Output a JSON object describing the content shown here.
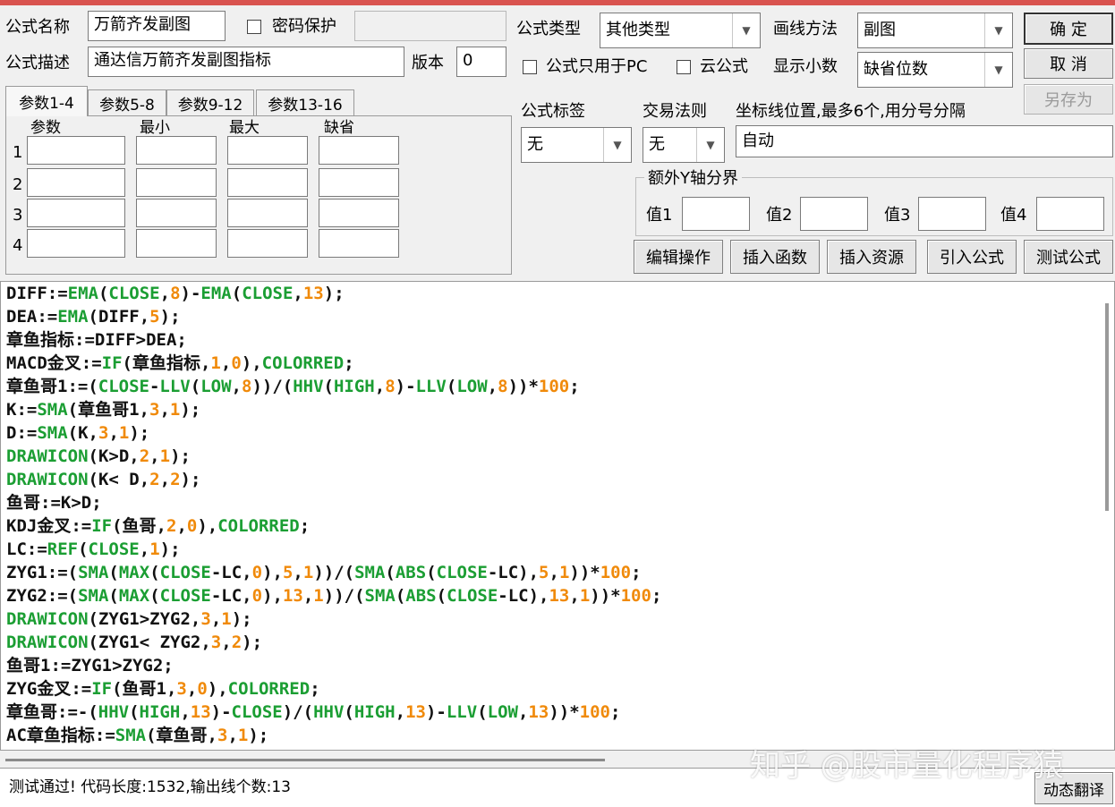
{
  "form": {
    "name_label": "公式名称",
    "name_value": "万箭齐发副图",
    "password_label": "密码保护",
    "password_value": "",
    "desc_label": "公式描述",
    "desc_value": "通达信万箭齐发副图指标",
    "version_label": "版本",
    "version_value": "0",
    "type_label": "公式类型",
    "type_value": "其他类型",
    "draw_label": "画线方法",
    "draw_value": "副图",
    "pc_only_label": "公式只用于PC",
    "cloud_label": "云公式",
    "decimals_label": "显示小数",
    "decimals_value": "缺省位数",
    "tag_label": "公式标签",
    "tag_value": "无",
    "trade_label": "交易法则",
    "trade_value": "无",
    "axis_label": "坐标线位置,最多6个,用分号分隔",
    "axis_value": "自动",
    "extra_y_label": "额外Y轴分界",
    "extra_y_vals": [
      "值1",
      "值2",
      "值3",
      "值4"
    ]
  },
  "buttons": {
    "ok": "确  定",
    "cancel": "取  消",
    "save_as": "另存为",
    "edit_ops": "编辑操作",
    "insert_func": "插入函数",
    "insert_res": "插入资源",
    "import_formula": "引入公式",
    "test_formula": "测试公式",
    "dyn_translate": "动态翻译"
  },
  "tabs": [
    "参数1-4",
    "参数5-8",
    "参数9-12",
    "参数13-16"
  ],
  "params": {
    "headers": [
      "参数",
      "最小",
      "最大",
      "缺省"
    ],
    "rows": [
      "1",
      "2",
      "3",
      "4"
    ]
  },
  "code_lines": [
    [
      [
        "t",
        "DIFF:="
      ],
      [
        "g",
        "EMA"
      ],
      [
        "t",
        "("
      ],
      [
        "g",
        "CLOSE"
      ],
      [
        "t",
        ","
      ],
      [
        "o",
        "8"
      ],
      [
        "t",
        ")-"
      ],
      [
        "g",
        "EMA"
      ],
      [
        "t",
        "("
      ],
      [
        "g",
        "CLOSE"
      ],
      [
        "t",
        ","
      ],
      [
        "o",
        "13"
      ],
      [
        "t",
        ");"
      ]
    ],
    [
      [
        "t",
        "DEA:="
      ],
      [
        "g",
        "EMA"
      ],
      [
        "t",
        "(DIFF,"
      ],
      [
        "o",
        "5"
      ],
      [
        "t",
        ");"
      ]
    ],
    [
      [
        "t",
        "章鱼指标:=DIFF>DEA;"
      ]
    ],
    [
      [
        "t",
        "MACD金叉:="
      ],
      [
        "g",
        "IF"
      ],
      [
        "t",
        "(章鱼指标,"
      ],
      [
        "o",
        "1"
      ],
      [
        "t",
        ","
      ],
      [
        "o",
        "0"
      ],
      [
        "t",
        "),"
      ],
      [
        "g",
        "COLORRED"
      ],
      [
        "t",
        ";"
      ]
    ],
    [
      [
        "t",
        "章鱼哥1:=("
      ],
      [
        "g",
        "CLOSE"
      ],
      [
        "t",
        "-"
      ],
      [
        "g",
        "LLV"
      ],
      [
        "t",
        "("
      ],
      [
        "g",
        "LOW"
      ],
      [
        "t",
        ","
      ],
      [
        "o",
        "8"
      ],
      [
        "t",
        "))/("
      ],
      [
        "g",
        "HHV"
      ],
      [
        "t",
        "("
      ],
      [
        "g",
        "HIGH"
      ],
      [
        "t",
        ","
      ],
      [
        "o",
        "8"
      ],
      [
        "t",
        ")-"
      ],
      [
        "g",
        "LLV"
      ],
      [
        "t",
        "("
      ],
      [
        "g",
        "LOW"
      ],
      [
        "t",
        ","
      ],
      [
        "o",
        "8"
      ],
      [
        "t",
        "))*"
      ],
      [
        "o",
        "100"
      ],
      [
        "t",
        ";"
      ]
    ],
    [
      [
        "t",
        "K:="
      ],
      [
        "g",
        "SMA"
      ],
      [
        "t",
        "(章鱼哥1,"
      ],
      [
        "o",
        "3"
      ],
      [
        "t",
        ","
      ],
      [
        "o",
        "1"
      ],
      [
        "t",
        ");"
      ]
    ],
    [
      [
        "t",
        "D:="
      ],
      [
        "g",
        "SMA"
      ],
      [
        "t",
        "(K,"
      ],
      [
        "o",
        "3"
      ],
      [
        "t",
        ","
      ],
      [
        "o",
        "1"
      ],
      [
        "t",
        ");"
      ]
    ],
    [
      [
        "g",
        "DRAWICON"
      ],
      [
        "t",
        "(K>D,"
      ],
      [
        "o",
        "2"
      ],
      [
        "t",
        ","
      ],
      [
        "o",
        "1"
      ],
      [
        "t",
        ");"
      ]
    ],
    [
      [
        "g",
        "DRAWICON"
      ],
      [
        "t",
        "(K< D,"
      ],
      [
        "o",
        "2"
      ],
      [
        "t",
        ","
      ],
      [
        "o",
        "2"
      ],
      [
        "t",
        ");"
      ]
    ],
    [
      [
        "t",
        "鱼哥:=K>D;"
      ]
    ],
    [
      [
        "t",
        "KDJ金叉:="
      ],
      [
        "g",
        "IF"
      ],
      [
        "t",
        "(鱼哥,"
      ],
      [
        "o",
        "2"
      ],
      [
        "t",
        ","
      ],
      [
        "o",
        "0"
      ],
      [
        "t",
        "),"
      ],
      [
        "g",
        "COLORRED"
      ],
      [
        "t",
        ";"
      ]
    ],
    [
      [
        "t",
        "LC:="
      ],
      [
        "g",
        "REF"
      ],
      [
        "t",
        "("
      ],
      [
        "g",
        "CLOSE"
      ],
      [
        "t",
        ","
      ],
      [
        "o",
        "1"
      ],
      [
        "t",
        ");"
      ]
    ],
    [
      [
        "t",
        "ZYG1:=("
      ],
      [
        "g",
        "SMA"
      ],
      [
        "t",
        "("
      ],
      [
        "g",
        "MAX"
      ],
      [
        "t",
        "("
      ],
      [
        "g",
        "CLOSE"
      ],
      [
        "t",
        "-LC,"
      ],
      [
        "o",
        "0"
      ],
      [
        "t",
        "),"
      ],
      [
        "o",
        "5"
      ],
      [
        "t",
        ","
      ],
      [
        "o",
        "1"
      ],
      [
        "t",
        "))/("
      ],
      [
        "g",
        "SMA"
      ],
      [
        "t",
        "("
      ],
      [
        "g",
        "ABS"
      ],
      [
        "t",
        "("
      ],
      [
        "g",
        "CLOSE"
      ],
      [
        "t",
        "-LC),"
      ],
      [
        "o",
        "5"
      ],
      [
        "t",
        ","
      ],
      [
        "o",
        "1"
      ],
      [
        "t",
        "))*"
      ],
      [
        "o",
        "100"
      ],
      [
        "t",
        ";"
      ]
    ],
    [
      [
        "t",
        "ZYG2:=("
      ],
      [
        "g",
        "SMA"
      ],
      [
        "t",
        "("
      ],
      [
        "g",
        "MAX"
      ],
      [
        "t",
        "("
      ],
      [
        "g",
        "CLOSE"
      ],
      [
        "t",
        "-LC,"
      ],
      [
        "o",
        "0"
      ],
      [
        "t",
        "),"
      ],
      [
        "o",
        "13"
      ],
      [
        "t",
        ","
      ],
      [
        "o",
        "1"
      ],
      [
        "t",
        "))/("
      ],
      [
        "g",
        "SMA"
      ],
      [
        "t",
        "("
      ],
      [
        "g",
        "ABS"
      ],
      [
        "t",
        "("
      ],
      [
        "g",
        "CLOSE"
      ],
      [
        "t",
        "-LC),"
      ],
      [
        "o",
        "13"
      ],
      [
        "t",
        ","
      ],
      [
        "o",
        "1"
      ],
      [
        "t",
        "))*"
      ],
      [
        "o",
        "100"
      ],
      [
        "t",
        ";"
      ]
    ],
    [
      [
        "g",
        "DRAWICON"
      ],
      [
        "t",
        "(ZYG1>ZYG2,"
      ],
      [
        "o",
        "3"
      ],
      [
        "t",
        ","
      ],
      [
        "o",
        "1"
      ],
      [
        "t",
        ");"
      ]
    ],
    [
      [
        "g",
        "DRAWICON"
      ],
      [
        "t",
        "(ZYG1< ZYG2,"
      ],
      [
        "o",
        "3"
      ],
      [
        "t",
        ","
      ],
      [
        "o",
        "2"
      ],
      [
        "t",
        ");"
      ]
    ],
    [
      [
        "t",
        "鱼哥1:=ZYG1>ZYG2;"
      ]
    ],
    [
      [
        "t",
        "ZYG金叉:="
      ],
      [
        "g",
        "IF"
      ],
      [
        "t",
        "(鱼哥1,"
      ],
      [
        "o",
        "3"
      ],
      [
        "t",
        ","
      ],
      [
        "o",
        "0"
      ],
      [
        "t",
        "),"
      ],
      [
        "g",
        "COLORRED"
      ],
      [
        "t",
        ";"
      ]
    ],
    [
      [
        "t",
        "章鱼哥:=-("
      ],
      [
        "g",
        "HHV"
      ],
      [
        "t",
        "("
      ],
      [
        "g",
        "HIGH"
      ],
      [
        "t",
        ","
      ],
      [
        "o",
        "13"
      ],
      [
        "t",
        ")-"
      ],
      [
        "g",
        "CLOSE"
      ],
      [
        "t",
        ")/("
      ],
      [
        "g",
        "HHV"
      ],
      [
        "t",
        "("
      ],
      [
        "g",
        "HIGH"
      ],
      [
        "t",
        ","
      ],
      [
        "o",
        "13"
      ],
      [
        "t",
        ")-"
      ],
      [
        "g",
        "LLV"
      ],
      [
        "t",
        "("
      ],
      [
        "g",
        "LOW"
      ],
      [
        "t",
        ","
      ],
      [
        "o",
        "13"
      ],
      [
        "t",
        "))*"
      ],
      [
        "o",
        "100"
      ],
      [
        "t",
        ";"
      ]
    ],
    [
      [
        "t",
        "AC章鱼指标:="
      ],
      [
        "g",
        "SMA"
      ],
      [
        "t",
        "(章鱼哥,"
      ],
      [
        "o",
        "3"
      ],
      [
        "t",
        ","
      ],
      [
        "o",
        "1"
      ],
      [
        "t",
        ");"
      ]
    ]
  ],
  "status_text": "测试通过! 代码长度:1532,输出线个数:13",
  "watermark": "知乎 @股市量化程序猿"
}
